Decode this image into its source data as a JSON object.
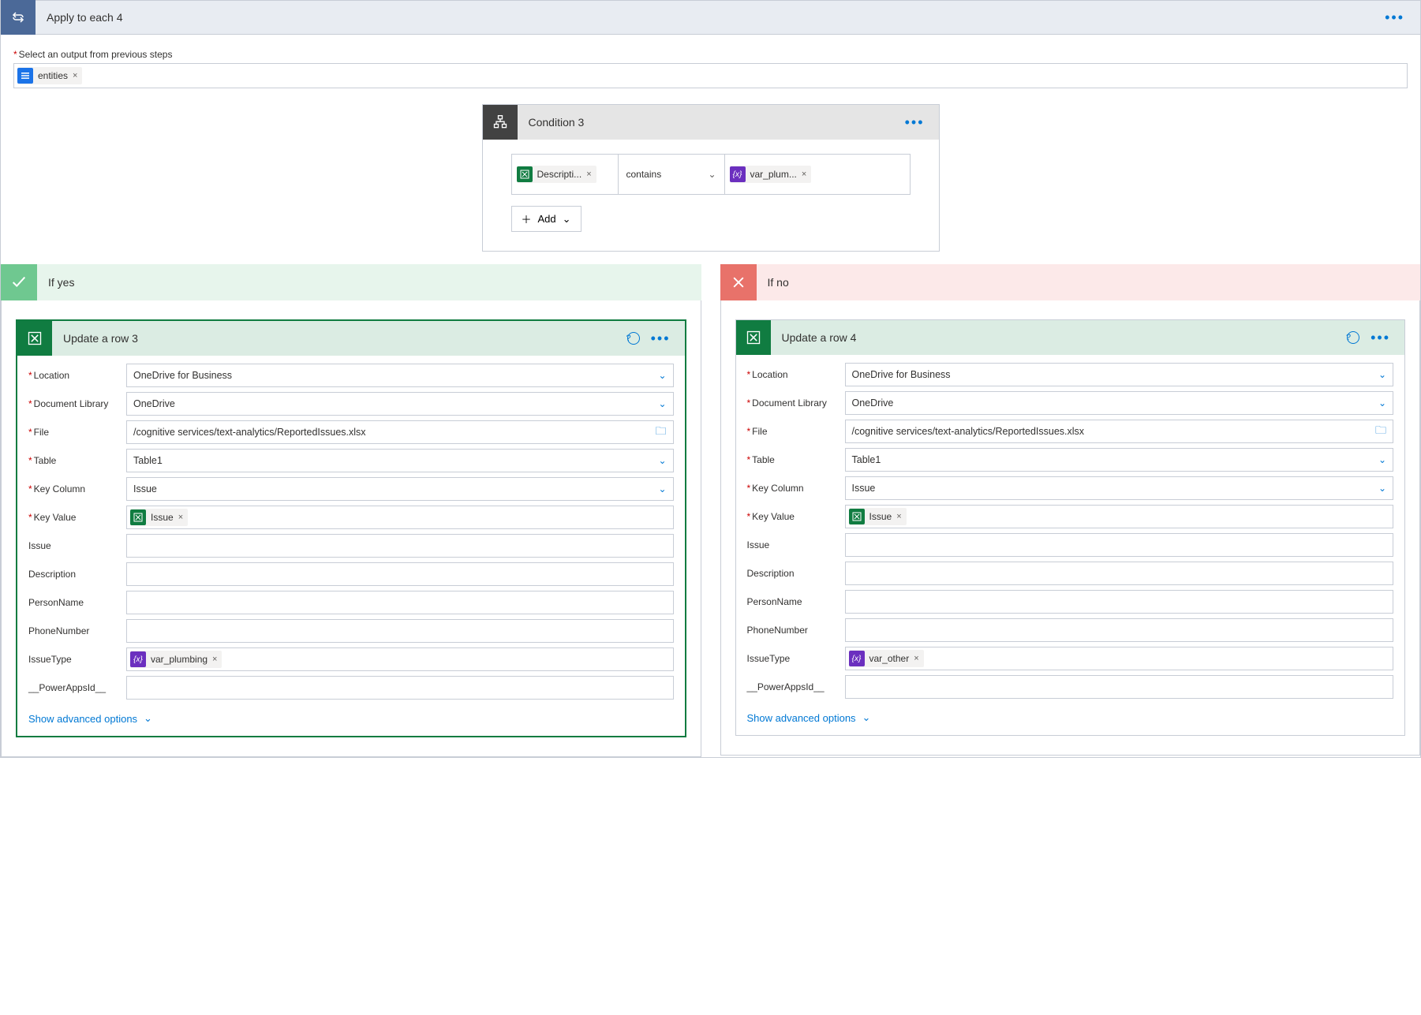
{
  "header": {
    "title": "Apply to each 4"
  },
  "selectOutput": {
    "label": "Select an output from previous steps",
    "token": "entities"
  },
  "condition": {
    "title": "Condition 3",
    "leftToken": "Descripti...",
    "operator": "contains",
    "rightToken": "var_plum...",
    "addLabel": "Add"
  },
  "branches": {
    "yes": {
      "title": "If yes"
    },
    "no": {
      "title": "If no"
    }
  },
  "updateRow3": {
    "title": "Update a row 3",
    "location": {
      "label": "Location",
      "value": "OneDrive for Business"
    },
    "documentLibrary": {
      "label": "Document Library",
      "value": "OneDrive"
    },
    "file": {
      "label": "File",
      "value": "/cognitive services/text-analytics/ReportedIssues.xlsx"
    },
    "table": {
      "label": "Table",
      "value": "Table1"
    },
    "keyColumn": {
      "label": "Key Column",
      "value": "Issue"
    },
    "keyValue": {
      "label": "Key Value",
      "token": "Issue"
    },
    "issue": {
      "label": "Issue"
    },
    "description": {
      "label": "Description"
    },
    "personName": {
      "label": "PersonName"
    },
    "phoneNumber": {
      "label": "PhoneNumber"
    },
    "issueType": {
      "label": "IssueType",
      "token": "var_plumbing"
    },
    "powerAppsId": {
      "label": "__PowerAppsId__"
    },
    "showAdvanced": "Show advanced options"
  },
  "updateRow4": {
    "title": "Update a row 4",
    "location": {
      "label": "Location",
      "value": "OneDrive for Business"
    },
    "documentLibrary": {
      "label": "Document Library",
      "value": "OneDrive"
    },
    "file": {
      "label": "File",
      "value": "/cognitive services/text-analytics/ReportedIssues.xlsx"
    },
    "table": {
      "label": "Table",
      "value": "Table1"
    },
    "keyColumn": {
      "label": "Key Column",
      "value": "Issue"
    },
    "keyValue": {
      "label": "Key Value",
      "token": "Issue"
    },
    "issue": {
      "label": "Issue"
    },
    "description": {
      "label": "Description"
    },
    "personName": {
      "label": "PersonName"
    },
    "phoneNumber": {
      "label": "PhoneNumber"
    },
    "issueType": {
      "label": "IssueType",
      "token": "var_other"
    },
    "powerAppsId": {
      "label": "__PowerAppsId__"
    },
    "showAdvanced": "Show advanced options"
  }
}
